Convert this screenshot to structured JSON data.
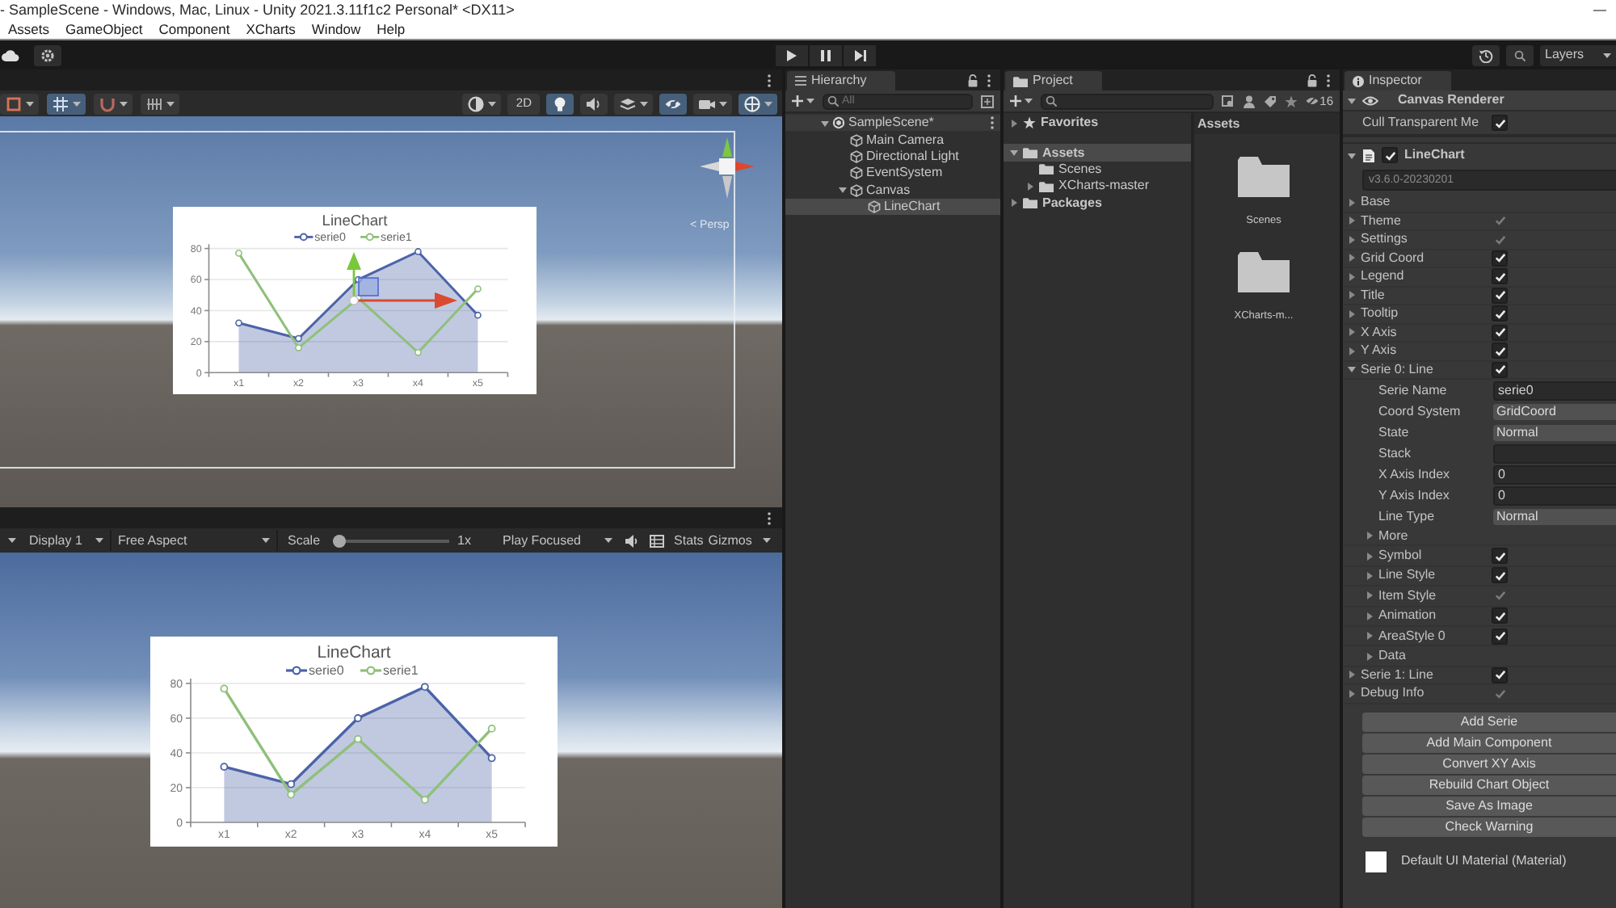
{
  "window": {
    "title": "- SampleScene - Windows, Mac, Linux - Unity 2021.3.11f1c2 Personal* <DX11>"
  },
  "menu_bar": [
    "Assets",
    "GameObject",
    "Component",
    "XCharts",
    "Window",
    "Help"
  ],
  "toolbar": {
    "layers": "Layers"
  },
  "scene_view": {
    "left_tools": [
      {
        "kind": "transform",
        "selected": false,
        "dropdown": true
      },
      {
        "kind": "grid",
        "selected": true,
        "dropdown": true
      },
      {
        "kind": "snap",
        "selected": false,
        "dropdown": true
      },
      {
        "kind": "increment",
        "selected": false,
        "dropdown": true
      }
    ],
    "right_tools": [
      {
        "kind": "shading",
        "selected": false,
        "dropdown": true
      },
      {
        "kind": "text",
        "label": "2D",
        "selected": false,
        "dropdown": false
      },
      {
        "kind": "light",
        "selected": true,
        "dropdown": false
      },
      {
        "kind": "audio",
        "selected": false,
        "dropdown": false
      },
      {
        "kind": "effects",
        "selected": false,
        "dropdown": true
      },
      {
        "kind": "visibility",
        "selected": true,
        "dropdown": false
      },
      {
        "kind": "camera",
        "selected": false,
        "dropdown": true
      },
      {
        "kind": "gizmos",
        "selected": true,
        "dropdown": true
      }
    ],
    "camera_label": "< Persp",
    "chart_data": {
      "type": "line",
      "title": "LineChart",
      "legend": "top",
      "grid": true,
      "categories": [
        "x1",
        "x2",
        "x3",
        "x4",
        "x5"
      ],
      "series": [
        {
          "name": "serie0",
          "type": "area",
          "color": "#4c63a8",
          "marker": "circle",
          "values": [
            32,
            22,
            60,
            78,
            37
          ]
        },
        {
          "name": "serie1",
          "type": "line",
          "color": "#8fc07a",
          "marker": "circle",
          "values": [
            77,
            16,
            48,
            13,
            54
          ]
        }
      ],
      "ylim": [
        0,
        80
      ],
      "yticks": [
        0,
        20,
        40,
        60,
        80
      ]
    }
  },
  "game_view": {
    "display": "Display 1",
    "aspect": "Free Aspect",
    "scale": {
      "label": "Scale",
      "level": 0,
      "reading": "1x"
    },
    "play_mode": "Play Focused",
    "stats": "Stats",
    "gizmos": "Gizmos",
    "chart_data": {
      "type": "line",
      "title": "LineChart",
      "legend": "top",
      "grid": true,
      "categories": [
        "x1",
        "x2",
        "x3",
        "x4",
        "x5"
      ],
      "series": [
        {
          "name": "serie0",
          "type": "area",
          "color": "#4c63a8",
          "marker": "circle",
          "values": [
            32,
            22,
            60,
            78,
            37
          ]
        },
        {
          "name": "serie1",
          "type": "line",
          "color": "#8fc07a",
          "marker": "circle",
          "values": [
            77,
            16,
            48,
            13,
            54
          ]
        }
      ],
      "ylim": [
        0,
        80
      ],
      "yticks": [
        0,
        20,
        40,
        60,
        80
      ]
    }
  },
  "hierarchy": {
    "title": "Hierarchy",
    "search": {
      "placeholder": "All"
    },
    "items": [
      {
        "label": "SampleScene*",
        "kind": "scene",
        "expanded": true,
        "selected": false,
        "children": [
          {
            "label": "Main Camera",
            "kind": "object",
            "selected": false
          },
          {
            "label": "Directional Light",
            "kind": "object",
            "selected": false
          },
          {
            "label": "EventSystem",
            "kind": "object",
            "selected": false
          },
          {
            "label": "Canvas",
            "kind": "object",
            "expanded": true,
            "selected": false,
            "children": [
              {
                "label": "LineChart",
                "kind": "object",
                "selected": true
              }
            ]
          }
        ]
      }
    ]
  },
  "project": {
    "title": "Project",
    "hidden_count": "16",
    "favorites": {
      "label": "Favorites",
      "expanded": false
    },
    "tree": [
      {
        "label": "Assets",
        "expanded": true,
        "selected": true,
        "children": [
          {
            "label": "Scenes",
            "selected": false
          },
          {
            "label": "XCharts-master",
            "expanded": false,
            "selected": false
          }
        ]
      },
      {
        "label": "Packages",
        "expanded": false,
        "selected": false
      }
    ],
    "breadcrumb": "Assets",
    "assets": [
      {
        "label": "Scenes",
        "kind": "folder"
      },
      {
        "label": "XCharts-m...",
        "kind": "folder"
      }
    ]
  },
  "inspector": {
    "title": "Inspector",
    "components": [
      {
        "kind": "header",
        "name": "Canvas Renderer",
        "expanded": true,
        "rows": [
          {
            "kind": "checkbox",
            "label": "Cull Transparent Me",
            "checked": true
          }
        ]
      },
      {
        "kind": "script",
        "name": "LineChart",
        "enabled": true,
        "expanded": true,
        "version": "v3.6.0-20230201",
        "rows": [
          {
            "kind": "foldout",
            "label": "Base",
            "expanded": false
          },
          {
            "kind": "toggle",
            "label": "Theme",
            "expanded": false,
            "checked": true,
            "disabled": true
          },
          {
            "kind": "toggle",
            "label": "Settings",
            "expanded": false,
            "checked": true,
            "disabled": true
          },
          {
            "kind": "toggle",
            "label": "Grid Coord",
            "expanded": false,
            "checked": true,
            "disabled": false
          },
          {
            "kind": "toggle",
            "label": "Legend",
            "expanded": false,
            "checked": true,
            "disabled": false
          },
          {
            "kind": "toggle",
            "label": "Title",
            "expanded": false,
            "checked": true,
            "disabled": false
          },
          {
            "kind": "toggle",
            "label": "Tooltip",
            "expanded": false,
            "checked": true,
            "disabled": false
          },
          {
            "kind": "toggle",
            "label": "X Axis",
            "expanded": false,
            "checked": true,
            "disabled": false
          },
          {
            "kind": "toggle",
            "label": "Y Axis",
            "expanded": false,
            "checked": true,
            "disabled": false
          },
          {
            "kind": "toggle",
            "label": "Serie 0: Line",
            "expanded": true,
            "checked": true,
            "disabled": false,
            "children": [
              {
                "kind": "field",
                "label": "Serie Name",
                "value": "serie0"
              },
              {
                "kind": "dropdown",
                "label": "Coord System",
                "value": "GridCoord"
              },
              {
                "kind": "dropdown",
                "label": "State",
                "value": "Normal"
              },
              {
                "kind": "field",
                "label": "Stack"
              },
              {
                "kind": "field",
                "label": "X Axis Index",
                "value": "0"
              },
              {
                "kind": "field",
                "label": "Y Axis Index",
                "value": "0"
              },
              {
                "kind": "dropdown",
                "label": "Line Type",
                "value": "Normal"
              },
              {
                "kind": "foldout",
                "label": "More",
                "expanded": false
              },
              {
                "kind": "toggle",
                "label": "Symbol",
                "expanded": false,
                "checked": true,
                "disabled": false
              },
              {
                "kind": "toggle",
                "label": "Line Style",
                "expanded": false,
                "checked": true,
                "disabled": false
              },
              {
                "kind": "toggle",
                "label": "Item Style",
                "expanded": false,
                "checked": true,
                "disabled": true
              },
              {
                "kind": "toggle",
                "label": "Animation",
                "expanded": false,
                "checked": true,
                "disabled": false
              },
              {
                "kind": "toggle",
                "label": "AreaStyle 0",
                "expanded": false,
                "checked": true,
                "disabled": false
              },
              {
                "kind": "foldout",
                "label": "Data",
                "expanded": false
              }
            ]
          },
          {
            "kind": "toggle",
            "label": "Serie 1: Line",
            "expanded": false,
            "checked": true,
            "disabled": false
          },
          {
            "kind": "toggle",
            "label": "Debug Info",
            "expanded": false,
            "checked": true,
            "disabled": true
          }
        ],
        "buttons": [
          "Add Serie",
          "Add Main Component",
          "Convert XY Axis",
          "Rebuild Chart Object",
          "Save As Image",
          "Check Warning"
        ]
      },
      {
        "kind": "material",
        "name": "Default UI Material (Material)"
      }
    ]
  }
}
